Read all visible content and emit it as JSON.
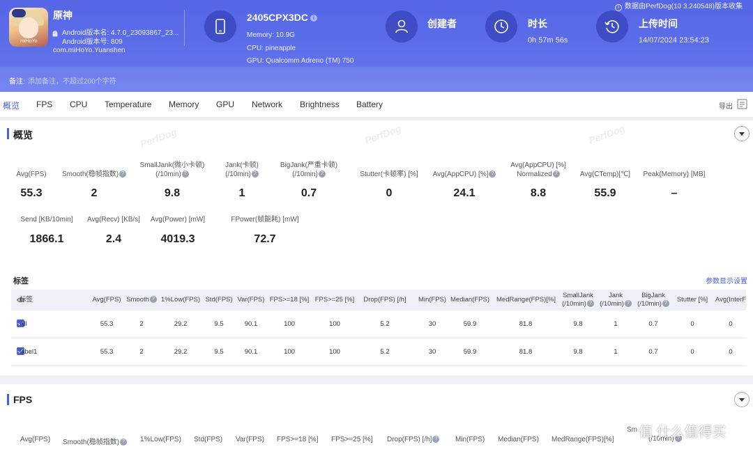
{
  "header": {
    "app": {
      "name": "原神",
      "version_name": "Android版本名: 4.7.0_23093867_23...",
      "version_code": "Android版本号: 809",
      "package": "com.miHoYo.Yuanshen",
      "icon_brand": "miHoYo"
    },
    "device": {
      "name": "2405CPX3DC",
      "memory": "Memory: 10.9G",
      "cpu": "CPU: pineapple",
      "gpu": "GPU: Qualcomm Adreno (TM) 750"
    },
    "creator": {
      "title": "创建者"
    },
    "duration": {
      "title": "时长",
      "value": "0h 57m 56s"
    },
    "upload": {
      "title": "上传时间",
      "value": "14/07/2024 23:54:23"
    },
    "collect_note": "数据由PerfDog(10.3.240548)版本收集",
    "note_label": "备注:",
    "note_placeholder": "添加备注，不超过200个字符"
  },
  "tabs": [
    "概览",
    "FPS",
    "CPU",
    "Temperature",
    "Memory",
    "GPU",
    "Network",
    "Brightness",
    "Battery"
  ],
  "export_label": "导出",
  "watermark": "PerfDog",
  "overview": {
    "title": "概览",
    "row1": [
      {
        "label": "Avg(FPS)",
        "value": "55.3"
      },
      {
        "label": "Smooth(稳帧指数)",
        "value": "2"
      },
      {
        "label": "SmallJank(微小卡顿)\n(/10min)",
        "value": "9.8"
      },
      {
        "label": "Jank(卡顿)\n(/10min)",
        "value": "1"
      },
      {
        "label": "BigJank(严重卡顿)\n(/10min)",
        "value": "0.7"
      },
      {
        "label": "Stutter(卡顿率) [%]",
        "value": "0"
      },
      {
        "label": "Avg(AppCPU) [%]",
        "value": "24.1"
      },
      {
        "label": "Avg(AppCPU) [%]\nNormalized",
        "value": "8.8"
      },
      {
        "label": "Avg(CTemp)[℃]",
        "value": "55.9"
      },
      {
        "label": "Peak(Memory) [MB]",
        "value": "–"
      }
    ],
    "row2": [
      {
        "label": "Send [KB/10min]",
        "value": "1866.1"
      },
      {
        "label": "Avg(Recv) [KB/s]",
        "value": "2.4"
      },
      {
        "label": "Avg(Power) [mW]",
        "value": "4019.3"
      },
      {
        "label": "FPower(帧能耗) [mW]",
        "value": "72.7"
      }
    ]
  },
  "tags": {
    "title": "标签",
    "param_link": "参数显示设置",
    "columns": [
      "标签",
      "Avg(FPS)",
      "Smooth",
      "1%Low(FPS)",
      "Std(FPS)",
      "Var(FPS)",
      "FPS>=18 [%]",
      "FPS>=25 [%]",
      "Drop(FPS) [/h]",
      "Min(FPS)",
      "Median(FPS)",
      "MedRange(FPS)[%]",
      "SmallJank\n(/10min)",
      "Jank\n(/10min)",
      "BigJank\n(/10min)",
      "Stutter [%]",
      "Avg(InterF"
    ],
    "rows": [
      [
        "All",
        "55.3",
        "2",
        "29.2",
        "9.5",
        "90.1",
        "100",
        "100",
        "5.2",
        "30",
        "59.9",
        "81.8",
        "9.8",
        "1",
        "0.7",
        "0",
        "0"
      ],
      [
        "label1",
        "55.3",
        "2",
        "29.2",
        "9.5",
        "90.1",
        "100",
        "100",
        "5.2",
        "30",
        "59.9",
        "81.8",
        "9.8",
        "1",
        "0.7",
        "0",
        "0"
      ]
    ]
  },
  "fps_section": {
    "title": "FPS",
    "labels": [
      "Avg(FPS)",
      "Smooth(稳帧指数)",
      "1%Low(FPS)",
      "Std(FPS)",
      "Var(FPS)",
      "FPS>=18 [%]",
      "FPS>=25 [%]",
      "Drop(FPS) [/h]",
      "Min(FPS)",
      "Median(FPS)",
      "MedRange(FPS)[%]",
      "Sm",
      "(/10min)"
    ]
  },
  "corner_watermark": "值 什么值得买"
}
